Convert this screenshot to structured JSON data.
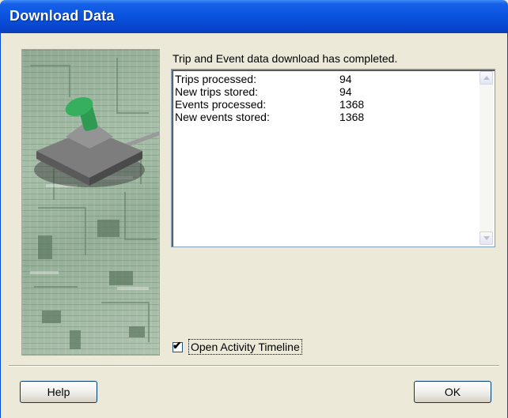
{
  "window": {
    "title": "Download Data"
  },
  "dialog": {
    "message": "Trip and Event data download has completed.",
    "results": [
      {
        "label": "Trips processed:",
        "value": "94"
      },
      {
        "label": "New trips stored:",
        "value": "94"
      },
      {
        "label": "Events processed:",
        "value": "1368"
      },
      {
        "label": "New events stored:",
        "value": "1368"
      }
    ],
    "checkbox": {
      "label": "Open Activity Timeline",
      "checked": true
    }
  },
  "buttons": {
    "help": "Help",
    "ok": "OK"
  },
  "colors": {
    "titlebar": "#0a54e0",
    "dialog_bg": "#ece9d8",
    "button_border": "#003c74"
  }
}
